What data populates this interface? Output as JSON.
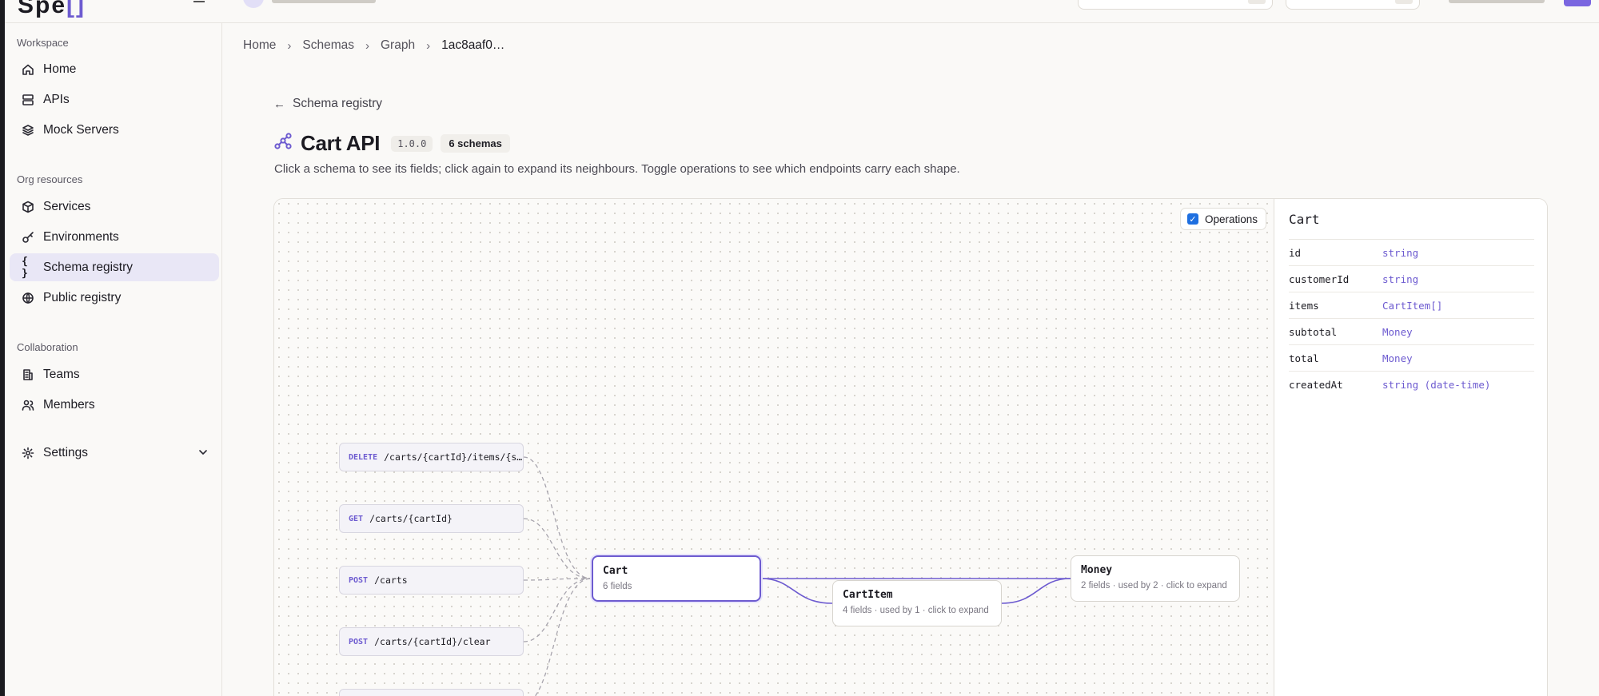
{
  "sidebar": {
    "sections": [
      {
        "title": "Workspace",
        "items": [
          {
            "label": "Home",
            "icon": "home-icon"
          },
          {
            "label": "APIs",
            "icon": "server-icon"
          },
          {
            "label": "Mock Servers",
            "icon": "layers-icon"
          }
        ]
      },
      {
        "title": "Org resources",
        "items": [
          {
            "label": "Services",
            "icon": "cube-icon"
          },
          {
            "label": "Environments",
            "icon": "key-icon"
          },
          {
            "label": "Schema registry",
            "icon": "braces-icon",
            "active": true
          },
          {
            "label": "Public registry",
            "icon": "globe-icon"
          }
        ]
      },
      {
        "title": "Collaboration",
        "items": [
          {
            "label": "Teams",
            "icon": "building-icon"
          },
          {
            "label": "Members",
            "icon": "users-icon"
          }
        ]
      }
    ],
    "settings": {
      "label": "Settings",
      "icon": "gear-icon"
    }
  },
  "breadcrumb": [
    "Home",
    "Schemas",
    "Graph",
    "1ac8aaf0…"
  ],
  "back_link": "Schema registry",
  "page": {
    "title": "Cart API",
    "version": "1.0.0",
    "schema_count": "6 schemas",
    "subtitle": "Click a schema to see its fields; click again to expand its neighbours. Toggle operations to see which endpoints carry each shape."
  },
  "graph": {
    "operations_toggle": {
      "label": "Operations",
      "checked": true
    },
    "operations": [
      {
        "method": "DELETE",
        "path": "/carts/{cartId}/items/{s…"
      },
      {
        "method": "GET",
        "path": "/carts/{cartId}"
      },
      {
        "method": "POST",
        "path": "/carts"
      },
      {
        "method": "POST",
        "path": "/carts/{cartId}/clear"
      }
    ],
    "schemas": {
      "cart": {
        "name": "Cart",
        "meta": "6 fields"
      },
      "cartitem": {
        "name": "CartItem",
        "meta": "4 fields · used by 1 · click to expand"
      },
      "money": {
        "name": "Money",
        "meta": "2 fields · used by 2 · click to expand"
      }
    }
  },
  "detail": {
    "title": "Cart",
    "fields": [
      {
        "name": "id",
        "type": "string"
      },
      {
        "name": "customerId",
        "type": "string"
      },
      {
        "name": "items",
        "type": "CartItem[]"
      },
      {
        "name": "subtotal",
        "type": "Money"
      },
      {
        "name": "total",
        "type": "Money"
      },
      {
        "name": "createdAt",
        "type": "string (date-time)"
      }
    ]
  },
  "colors": {
    "accent": "#6d5bd0",
    "checkbox": "#1e6fe0"
  }
}
